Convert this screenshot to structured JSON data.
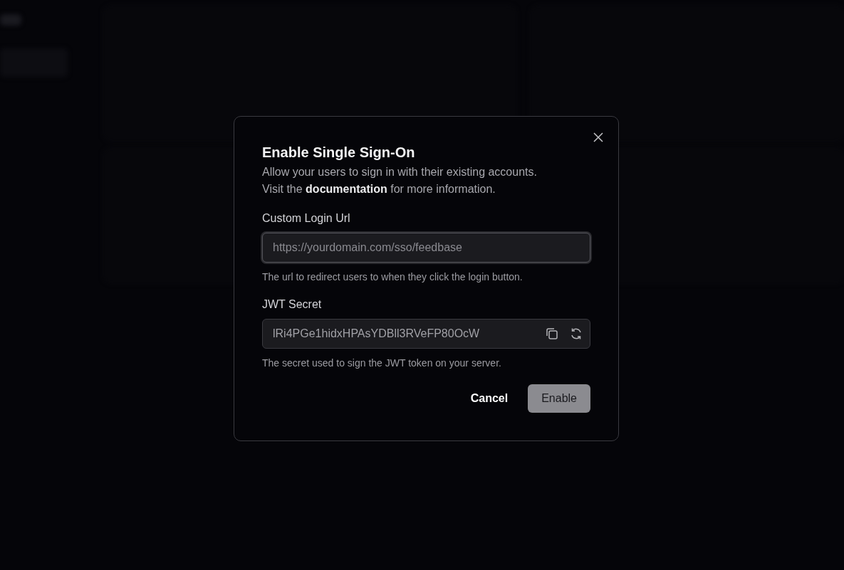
{
  "dialog": {
    "title": "Enable Single Sign-On",
    "description": {
      "line_1": "Allow your users to sign in with their existing accounts.",
      "before_link": "Visit the",
      "link": "documentation",
      "after_link": "for more information."
    },
    "fields": [
      {
        "kind": "text",
        "label": "Custom Login Url",
        "placeholder": "https://yourdomain.com/sso/feedbase",
        "focused": true,
        "help": "The url to redirect users to when they click the login button."
      },
      {
        "kind": "secret",
        "label": "JWT Secret",
        "value": "lRi4PGe1hidxHPAsYDBll3RVeFP80OcW",
        "focused": false,
        "help": "The secret used to sign the JWT token on your server."
      }
    ],
    "cancel_button": "Cancel",
    "enable_button": {
      "label": "Enable",
      "disabled": true
    }
  }
}
